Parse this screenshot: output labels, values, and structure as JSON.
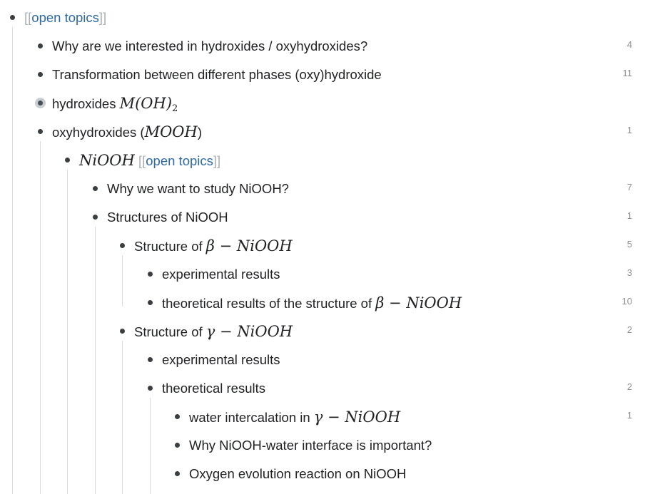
{
  "outline": [
    {
      "level": 0,
      "parts": [
        {
          "t": "bracket",
          "v": "[["
        },
        {
          "t": "link",
          "v": "open topics"
        },
        {
          "t": "bracket",
          "v": "]]"
        }
      ],
      "count": ""
    },
    {
      "level": 1,
      "parts": [
        {
          "t": "text",
          "v": "Why are we interested in hydroxides / oxyhydroxides?"
        }
      ],
      "count": "4"
    },
    {
      "level": 1,
      "parts": [
        {
          "t": "text",
          "v": "Transformation between different phases (oxy)hydroxide"
        }
      ],
      "count": "11"
    },
    {
      "level": 1,
      "collapsed": true,
      "parts": [
        {
          "t": "text",
          "v": "hydroxides "
        },
        {
          "t": "math",
          "v": "M(OH)",
          "sub": "2"
        }
      ],
      "count": ""
    },
    {
      "level": 1,
      "parts": [
        {
          "t": "text",
          "v": "oxyhydroxides ("
        },
        {
          "t": "math",
          "v": "MOOH"
        },
        {
          "t": "text",
          "v": ")"
        }
      ],
      "count": "1"
    },
    {
      "level": 2,
      "parts": [
        {
          "t": "math",
          "v": "NiOOH"
        },
        {
          "t": "text",
          "v": " "
        },
        {
          "t": "bracket",
          "v": "[["
        },
        {
          "t": "link",
          "v": "open topics"
        },
        {
          "t": "bracket",
          "v": "]]"
        }
      ],
      "count": ""
    },
    {
      "level": 3,
      "parts": [
        {
          "t": "text",
          "v": "Why we want to study NiOOH?"
        }
      ],
      "count": "7"
    },
    {
      "level": 3,
      "parts": [
        {
          "t": "text",
          "v": "Structures of NiOOH"
        }
      ],
      "count": "1"
    },
    {
      "level": 4,
      "parts": [
        {
          "t": "text",
          "v": "Structure of "
        },
        {
          "t": "math",
          "v": "β − NiOOH"
        }
      ],
      "count": "5"
    },
    {
      "level": 5,
      "parts": [
        {
          "t": "text",
          "v": "experimental results"
        }
      ],
      "count": "3"
    },
    {
      "level": 5,
      "parts": [
        {
          "t": "text",
          "v": "theoretical results of the structure of "
        },
        {
          "t": "math",
          "v": "β − NiOOH"
        }
      ],
      "count": "10"
    },
    {
      "level": 4,
      "parts": [
        {
          "t": "text",
          "v": "Structure of "
        },
        {
          "t": "math",
          "v": "γ − NiOOH"
        }
      ],
      "count": "2"
    },
    {
      "level": 5,
      "parts": [
        {
          "t": "text",
          "v": "experimental results"
        }
      ],
      "count": ""
    },
    {
      "level": 5,
      "parts": [
        {
          "t": "text",
          "v": "theoretical results"
        }
      ],
      "count": "2"
    },
    {
      "level": 6,
      "parts": [
        {
          "t": "text",
          "v": "water intercalation in "
        },
        {
          "t": "math",
          "v": "γ − NiOOH"
        }
      ],
      "count": "1"
    },
    {
      "level": 6,
      "parts": [
        {
          "t": "text",
          "v": "Why NiOOH-water interface is important?"
        }
      ],
      "count": ""
    },
    {
      "level": 6,
      "parts": [
        {
          "t": "text",
          "v": "Oxygen evolution reaction on NiOOH"
        }
      ],
      "count": ""
    }
  ]
}
